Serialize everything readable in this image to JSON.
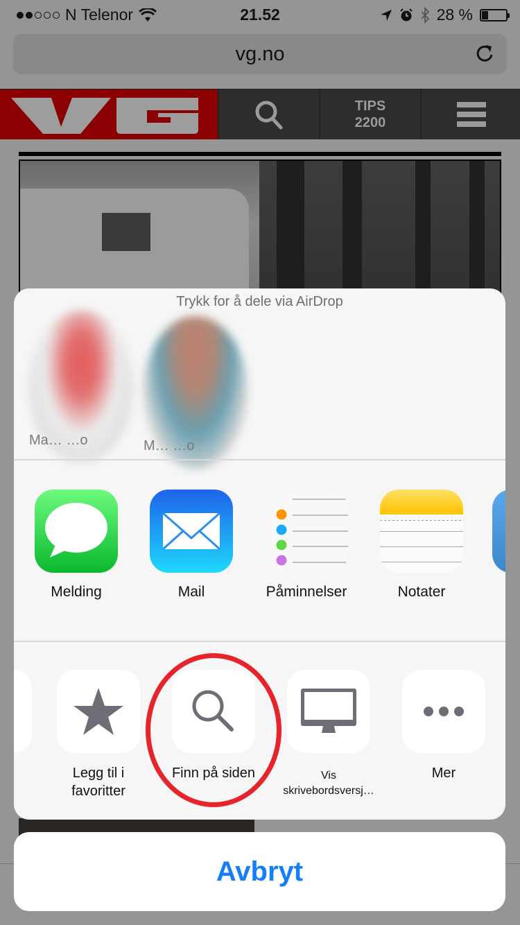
{
  "status_bar": {
    "signal_bars_filled": 2,
    "signal_bars_total": 5,
    "carrier": "N Telenor",
    "time": "21.52",
    "battery_text": "28 %",
    "battery_level": 0.28,
    "icons": [
      "wifi-icon",
      "location-arrow-icon",
      "alarm-icon",
      "bluetooth-icon",
      "battery-icon"
    ]
  },
  "browser": {
    "url": "vg.no",
    "reload_icon": "reload-icon"
  },
  "site_header": {
    "logo": "VG",
    "search_icon": "search-icon",
    "tips_line1": "TIPS",
    "tips_line2": "2200",
    "menu_icon": "hamburger-menu-icon"
  },
  "share_sheet": {
    "airdrop_title": "Trykk for å dele via AirDrop",
    "contacts": [
      {
        "name": "Ma… …o"
      },
      {
        "name": "M… …o"
      }
    ],
    "apps": [
      {
        "label": "Melding",
        "icon": "messages-icon"
      },
      {
        "label": "Mail",
        "icon": "mail-icon"
      },
      {
        "label": "Påminnelser",
        "icon": "reminders-icon"
      },
      {
        "label": "Notater",
        "icon": "notes-icon"
      }
    ],
    "actions": [
      {
        "label": "Legg til i favoritter",
        "icon": "star-icon"
      },
      {
        "label": "Finn på siden",
        "icon": "search-icon"
      },
      {
        "label": "Vis skrivebordsversj…",
        "icon": "desktop-icon"
      },
      {
        "label": "Mer",
        "icon": "more-icon"
      }
    ],
    "cancel_label": "Avbryt",
    "highlight_color": "#e7232b",
    "cancel_color": "#157efb"
  }
}
